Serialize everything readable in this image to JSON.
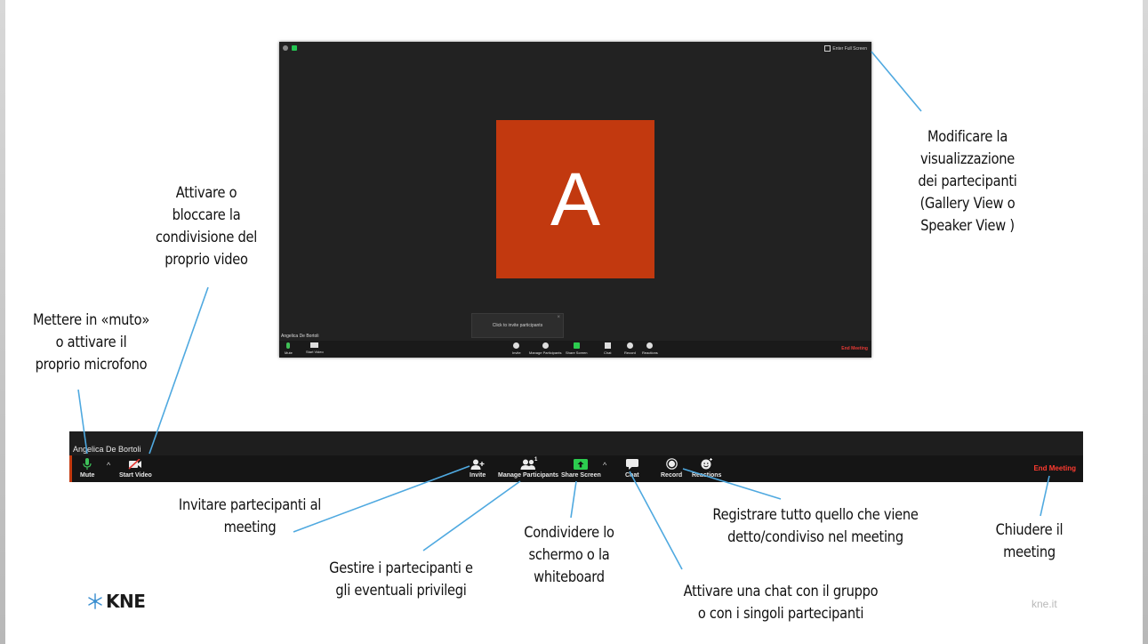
{
  "zoom_window": {
    "fullscreen_label": "Enter Full Screen",
    "avatar_letter": "A",
    "invite_popup": "Click to invite participants",
    "participant_name": "Angelica De Bortoli",
    "toolbar": {
      "mute": "Mute",
      "start_video": "Start Video",
      "invite": "Invite",
      "manage_participants": "Manage Participants",
      "participants_count": "1",
      "share_screen": "Share Screen",
      "chat": "Chat",
      "record": "Record",
      "reactions": "Reactions",
      "end_meeting": "End Meeting"
    }
  },
  "big_toolbar": {
    "participant_name": "Angelica De Bortoli",
    "mute": "Mute",
    "start_video": "Start Video",
    "invite": "Invite",
    "manage_participants": "Manage Participants",
    "participants_count": "1",
    "share_screen": "Share Screen",
    "chat": "Chat",
    "record": "Record",
    "reactions": "Reactions",
    "end_meeting": "End Meeting"
  },
  "annotations": {
    "view": [
      "Modificare la",
      "visualizzazione",
      "dei partecipanti",
      "(Gallery View o",
      "Speaker View )"
    ],
    "video": [
      "Attivare o",
      "bloccare la",
      "condivisione del",
      "proprio video"
    ],
    "mute": [
      "Mettere in «muto»",
      "o attivare il",
      "proprio microfono"
    ],
    "invite": [
      "Invitare partecipanti al",
      "meeting"
    ],
    "manage": [
      "Gestire i partecipanti e",
      "gli eventuali privilegi"
    ],
    "share": [
      "Condividere lo",
      "schermo o la",
      "whiteboard"
    ],
    "chat": [
      "Attivare una chat con il gruppo",
      "o con i singoli partecipanti"
    ],
    "record": [
      "Registrare tutto quello che viene",
      "detto/condiviso nel meeting"
    ],
    "end": [
      "Chiudere il",
      "meeting"
    ]
  },
  "logo": {
    "name": "KNE",
    "icon": "snowflake-icon"
  },
  "site": "kne.it",
  "colors": {
    "accent_line": "#4fa9e0",
    "avatar_bg": "#c2390f",
    "end_red": "#ff3b30",
    "share_green": "#2ccc4f"
  }
}
